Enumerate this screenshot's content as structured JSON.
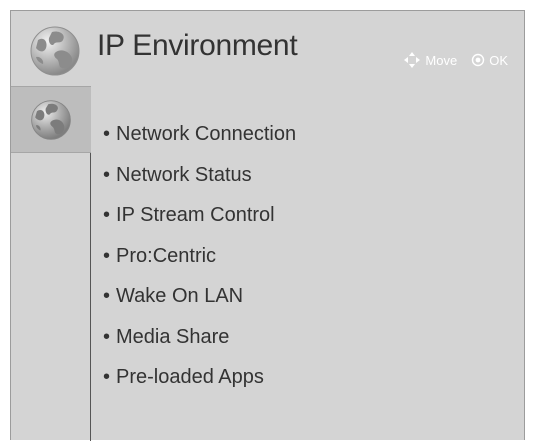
{
  "header": {
    "title": "IP Environment",
    "hints": [
      {
        "icon": "dpad-arrows-icon",
        "label": "Move"
      },
      {
        "icon": "ok-circle-icon",
        "label": "OK"
      }
    ]
  },
  "sidebar": {
    "items": [
      {
        "icon": "globe-icon",
        "selected": true
      }
    ]
  },
  "menu": {
    "items": [
      {
        "label": "Network Connection"
      },
      {
        "label": "Network Status"
      },
      {
        "label": "IP Stream Control"
      },
      {
        "label": "Pro:Centric"
      },
      {
        "label": "Wake On LAN"
      },
      {
        "label": "Media Share"
      },
      {
        "label": "Pre-loaded Apps"
      }
    ]
  },
  "colors": {
    "panel_background": "#d4d4d4",
    "sidebar_selected": "#bdbdbd",
    "text": "#333333",
    "hint_text": "#ffffff"
  }
}
